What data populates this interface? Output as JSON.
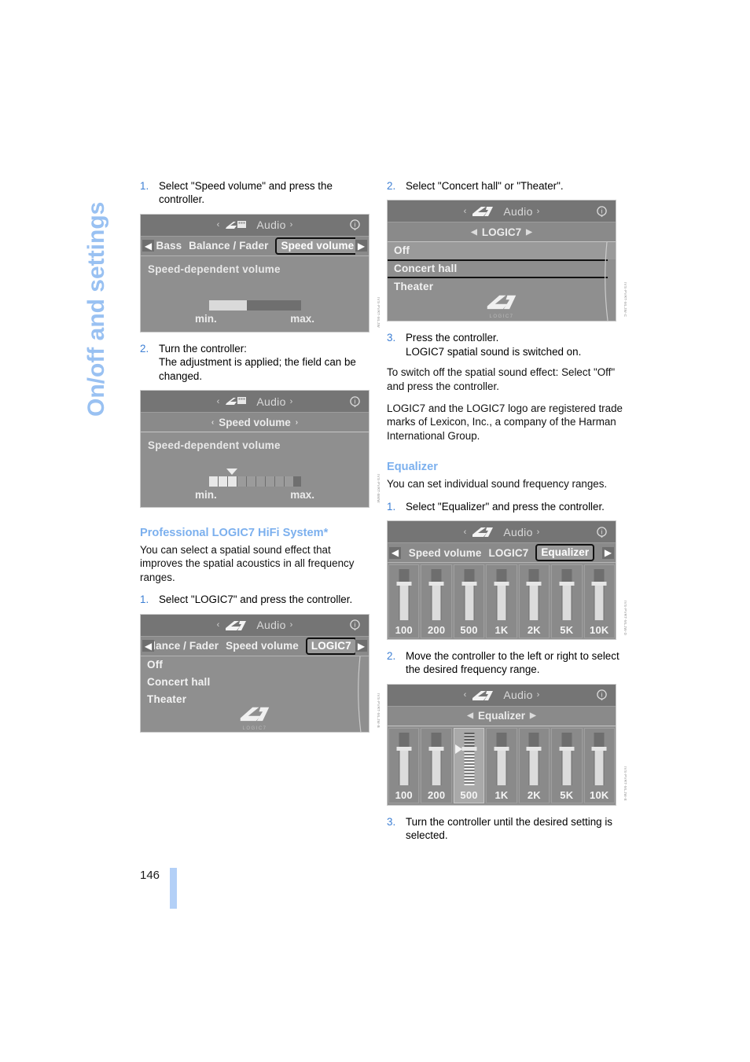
{
  "chapter_title": "On/off and settings",
  "page_number": "146",
  "accent_colors": {
    "heading_blue": "#7cb0ee",
    "step_number_blue": "#3d7fd4",
    "side_title_blue": "#99c1f2",
    "footer_bar_blue": "#b3d0f7",
    "screen_bg_gray": "#8f8f8f"
  },
  "left_column": {
    "step1": {
      "num": "1.",
      "text": "Select \"Speed volume\" and press the controller."
    },
    "screen1": {
      "header_title": "Audio",
      "header_left_arrow": "‹",
      "header_right_arrow": "›",
      "info_icon": "info-icon",
      "tab_arrow_left": "◀",
      "tab_arrow_right": "▶",
      "tabs": [
        "/ Bass",
        "Balance / Fader",
        "Speed volume"
      ],
      "selected_tab": "Speed volume",
      "body_label": "Speed-dependent volume",
      "slider_min_label": "min.",
      "slider_max_label": "max."
    },
    "step2": {
      "num": "2.",
      "line1": "Turn the controller:",
      "line2": "The adjustment is applied; the field can be changed."
    },
    "screen2": {
      "header_title": "Audio",
      "nav_label": "Speed volume",
      "nav_left_arrow": "‹",
      "nav_right_arrow": "›",
      "body_label": "Speed-dependent volume",
      "slider_min_label": "min.",
      "slider_max_label": "max."
    },
    "section_heading": "Professional LOGIC7 HiFi System*",
    "section_para": "You can select a spatial sound effect that improves the spatial acoustics in all frequency ranges.",
    "step3": {
      "num": "1.",
      "text": "Select \"LOGIC7\" and press the controller."
    },
    "screen3": {
      "header_title": "Audio",
      "tabs": [
        "lance / Fader",
        "Speed volume",
        "LOGIC7"
      ],
      "selected_tab": "LOGIC7",
      "rows": [
        "Off",
        "Concert hall",
        "Theater"
      ],
      "logo_caption": "LOGIC7"
    }
  },
  "right_column": {
    "step1": {
      "num": "2.",
      "text": "Select \"Concert hall\" or \"Theater\"."
    },
    "screen1": {
      "header_title": "Audio",
      "nav_label": "LOGIC7",
      "rows": [
        "Off",
        "Concert hall",
        "Theater"
      ],
      "selected_row": "Concert hall",
      "logo_caption": "LOGIC7"
    },
    "step2": {
      "num": "3.",
      "line1": "Press the controller.",
      "line2": "LOGIC7 spatial sound is switched on."
    },
    "para1": "To switch off the spatial sound effect: Select \"Off\" and press the controller.",
    "para2": "LOGIC7 and the LOGIC7 logo are registered trade marks of Lexicon, Inc., a company of the Harman International Group.",
    "section_heading": "Equalizer",
    "section_para": "You can set individual sound frequency ranges.",
    "step3": {
      "num": "1.",
      "text": "Select \"Equalizer\" and press the controller."
    },
    "screen2": {
      "header_title": "Audio",
      "tabs": [
        "Speed volume",
        "LOGIC7",
        "Equalizer"
      ],
      "selected_tab": "Equalizer",
      "bands": [
        "100",
        "200",
        "500",
        "1K",
        "2K",
        "5K",
        "10K"
      ]
    },
    "step4": {
      "num": "2.",
      "text": "Move the controller to the left or right to select the desired frequency range."
    },
    "screen3": {
      "header_title": "Audio",
      "nav_label": "Equalizer",
      "bands": [
        "100",
        "200",
        "500",
        "1K",
        "2K",
        "5K",
        "10K"
      ],
      "active_band": "500"
    },
    "step5": {
      "num": "3.",
      "text": "Turn the controller until the desired setting is selected."
    }
  }
}
